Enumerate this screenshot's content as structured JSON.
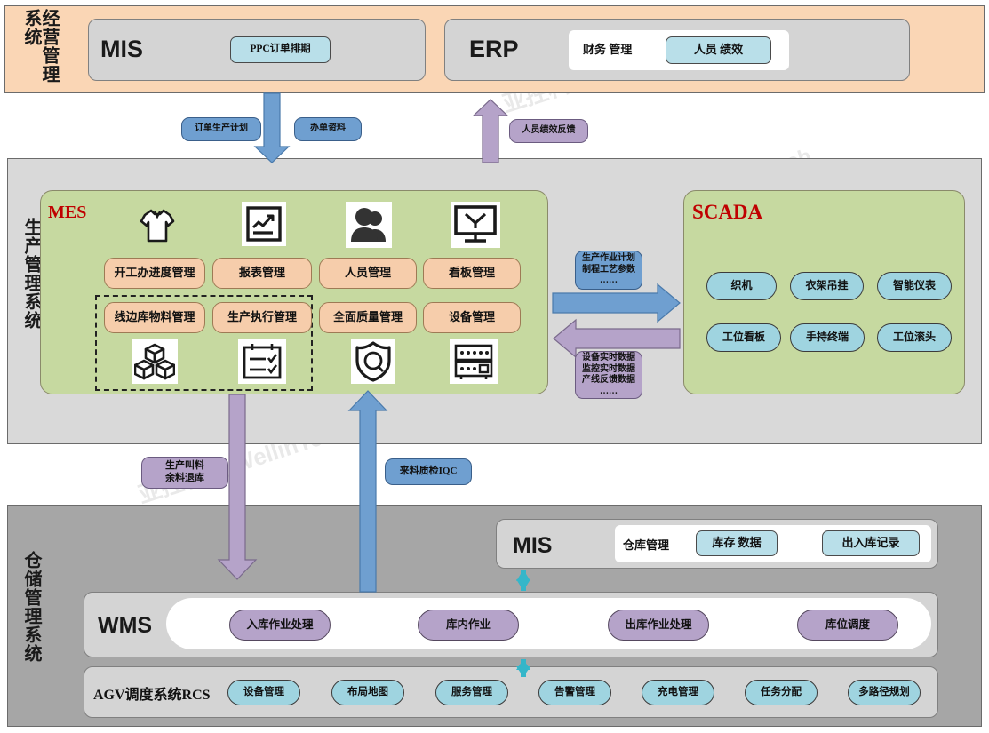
{
  "layers": {
    "business": {
      "side_label": "经营管理系统"
    },
    "production": {
      "side_label": "生产管理系统"
    },
    "warehouse": {
      "side_label": "仓储管理系统"
    }
  },
  "business_layer": {
    "mis": {
      "title": "MIS",
      "modules": [
        "PPC订单排期"
      ]
    },
    "erp": {
      "title": "ERP",
      "plain_label": "财务 管理",
      "modules": [
        "人员 绩效"
      ]
    }
  },
  "flow_labels": {
    "order_plan": "订单生产计划",
    "order_data": "办单资料",
    "hr_feedback": "人员绩效反馈",
    "mes_to_scada": "生产作业计划\n制程工艺参数\n……",
    "mes_to_scada_lines": [
      "生产作业计划",
      "制程工艺参数",
      "……"
    ],
    "scada_to_mes_lines": [
      "设备实时数据",
      "监控实时数据",
      "产线反馈数据",
      "……"
    ],
    "mes_to_wms_lines": [
      "生产叫料",
      "余料退库"
    ],
    "wms_to_mes": "来料质检IQC"
  },
  "mes": {
    "tag": "MES",
    "row1": [
      {
        "label": "开工办进度管理",
        "icon": "tshirt-icon"
      },
      {
        "label": "报表管理",
        "icon": "chart-report-icon"
      },
      {
        "label": "人员管理",
        "icon": "people-icon"
      },
      {
        "label": "看板管理",
        "icon": "monitor-icon"
      }
    ],
    "row2": [
      {
        "label": "线边库物料管理",
        "icon": "boxes-icon"
      },
      {
        "label": "生产执行管理",
        "icon": "checklist-icon"
      },
      {
        "label": "全面质量管理",
        "icon": "quality-shield-icon"
      },
      {
        "label": "设备管理",
        "icon": "machine-icon"
      }
    ]
  },
  "scada": {
    "tag": "SCADA",
    "row1": [
      "织机",
      "衣架吊挂",
      "智能仪表"
    ],
    "row2": [
      "工位看板",
      "手持终端",
      "工位滚头"
    ]
  },
  "warehouse_layer": {
    "mis": {
      "title": "MIS",
      "plain_label": "仓库管理",
      "modules": [
        "库存 数据",
        "出入库记录"
      ]
    },
    "wms": {
      "title": "WMS",
      "modules": [
        "入库作业处理",
        "库内作业",
        "出库作业处理",
        "库位调度"
      ]
    },
    "rcs": {
      "title": "AGV调度系统RCS",
      "modules": [
        "设备管理",
        "布局地图",
        "服务管理",
        "告警管理",
        "充电管理",
        "任务分配",
        "多路径规划"
      ]
    }
  },
  "watermarks": [
    "亚控科技 WellinTech",
    "亚控科技 WellinTech",
    "亚控科技 WellinTech",
    "亚控科技 WellinTech",
    "WellinTech",
    "亚控科技",
    "WellinTech"
  ],
  "colors": {
    "band_top": "#fad6b5",
    "band_mid": "#d9d9d9",
    "band_bottom": "#a6a6a6",
    "panel_green": "#c6d9a0",
    "pill_blue": "#b9dfe9",
    "pill_peach": "#f6cdab",
    "pill_purple": "#b5a3c9",
    "pill_cyan": "#9fd4e0",
    "arrow_blue": "#6f9fd0",
    "arrow_purple": "#b5a3c9",
    "arrow_teal": "#35b6c9",
    "tag_red": "#c00000"
  }
}
